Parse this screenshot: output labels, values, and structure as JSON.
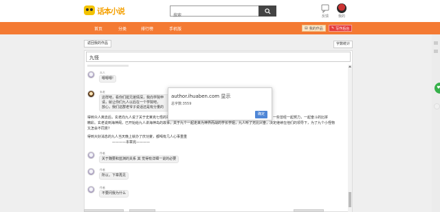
{
  "header": {
    "logo_text": "话本小说",
    "search_placeholder": "搜索",
    "icons": [
      {
        "label": "反馈",
        "icon": "feedback-icon"
      },
      {
        "label": "我的",
        "icon": "avatar"
      }
    ]
  },
  "nav": {
    "items": [
      "首页",
      "分类",
      "排行榜",
      "手机版"
    ],
    "buttons": {
      "manage": "我的作品",
      "write": "写作后台"
    }
  },
  "toolbar": {
    "back": "返回我的作品",
    "word_count": "字数统计"
  },
  "editor": {
    "title": "九怪"
  },
  "messages": [
    {
      "type": "bubble",
      "sender": "众人",
      "text": "嗯嗯嗯!",
      "avatar": "default"
    },
    {
      "type": "bubble",
      "sender": "玄老",
      "text": "这样吧，看你们挺兄弟情深，我向学院申\n请，就让你们九人以后在一个学院吧，\n放心，我们这群老爷子说话还是有分量的",
      "avatar": "alt"
    },
    {
      "type": "narration",
      "text": "得到众人离去后，玄老向九人说了关于史莱克七怪的事迹，这让九人心中对老一辈的学长学姐们所发生的故事充满了向往，一些曾经一起努力，一起奋斗的比拼\n精彩。玄老说到海神阁，已开始给九人讲海神岛的故事，关于九个一起走来为神界而战的学长学姐，九人听了无比兴奋，决定继续在他们的领导下，为了九个小怪物\n又怎会不同意?"
    },
    {
      "type": "narration",
      "text": "得到大好消息的九人当天晚上就办了庆功宴，都喝有几人心事重重"
    },
    {
      "type": "narration",
      "text": "————本章完————"
    },
    {
      "type": "bubble",
      "sender": "作者",
      "text": "关于魏要和蓝渊的关系 其 觉得有详细一说的必要",
      "avatar": "default"
    },
    {
      "type": "bubble",
      "sender": "作者",
      "text": "所以，下章再见",
      "avatar": "default"
    },
    {
      "type": "bubble",
      "sender": "作者",
      "text": "不要问我为什么",
      "avatar": "default"
    }
  ],
  "dialog": {
    "title": "author.ihuaben.com 显示",
    "message": "总字数:3559",
    "ok": "确定"
  },
  "side_widget": {
    "label": "♥"
  },
  "colors": {
    "nav_bg": "#f47a33",
    "dialog_button": "#4f86d6",
    "write_button": "#e53d3d"
  }
}
